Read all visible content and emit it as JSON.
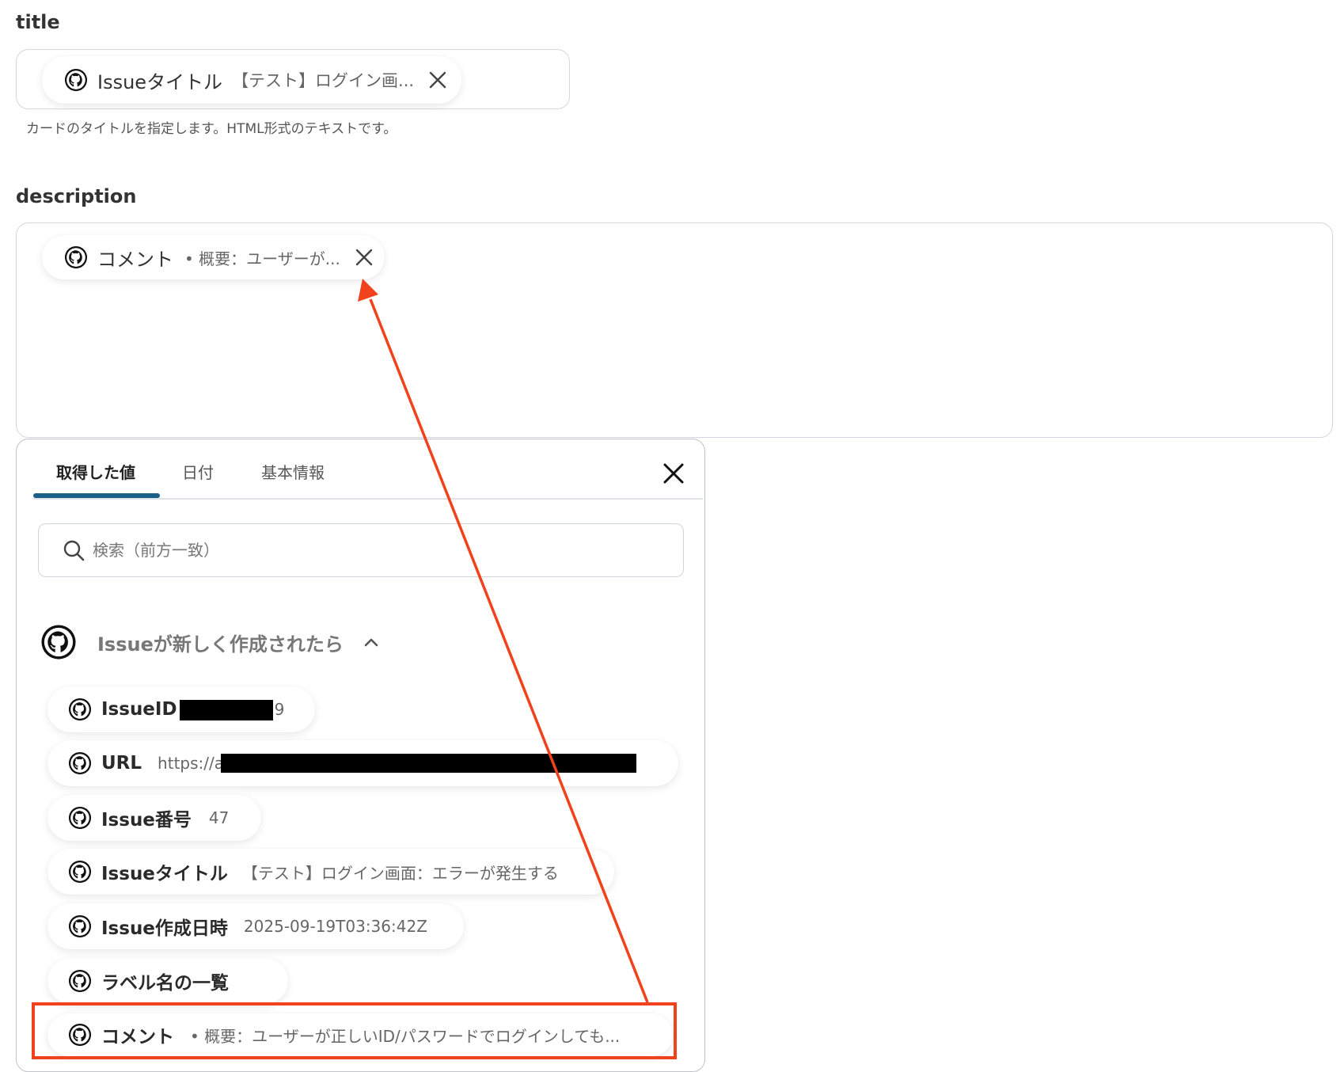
{
  "title_field": {
    "label": "title",
    "chip_name": "Issueタイトル",
    "chip_value": "【テスト】ログイン画...",
    "hint": "カードのタイトルを指定します。HTML形式のテキストです。"
  },
  "description_field": {
    "label": "description",
    "chip_name": "コメント",
    "chip_value": "• 概要：ユーザーが..."
  },
  "popup": {
    "tabs": [
      "取得した値",
      "日付",
      "基本情報"
    ],
    "search_placeholder": "検索（前方一致）",
    "group_name": "Issueが新しく作成されたら",
    "items": [
      {
        "name": "IssueID",
        "value": "9"
      },
      {
        "name": "URL",
        "value": "https://a"
      },
      {
        "name": "Issue番号",
        "value": "47"
      },
      {
        "name": "Issueタイトル",
        "value": "【テスト】ログイン画面：エラーが発生する"
      },
      {
        "name": "Issue作成日時",
        "value": "2025-09-19T03:36:42Z"
      },
      {
        "name": "ラベル名の一覧",
        "value": ""
      },
      {
        "name": "コメント",
        "value": "• 概要：ユーザーが正しいID/パスワードでログインしても..."
      }
    ]
  },
  "colors": {
    "annotation": "#f0421c",
    "tab_active": "#1b5f86"
  }
}
